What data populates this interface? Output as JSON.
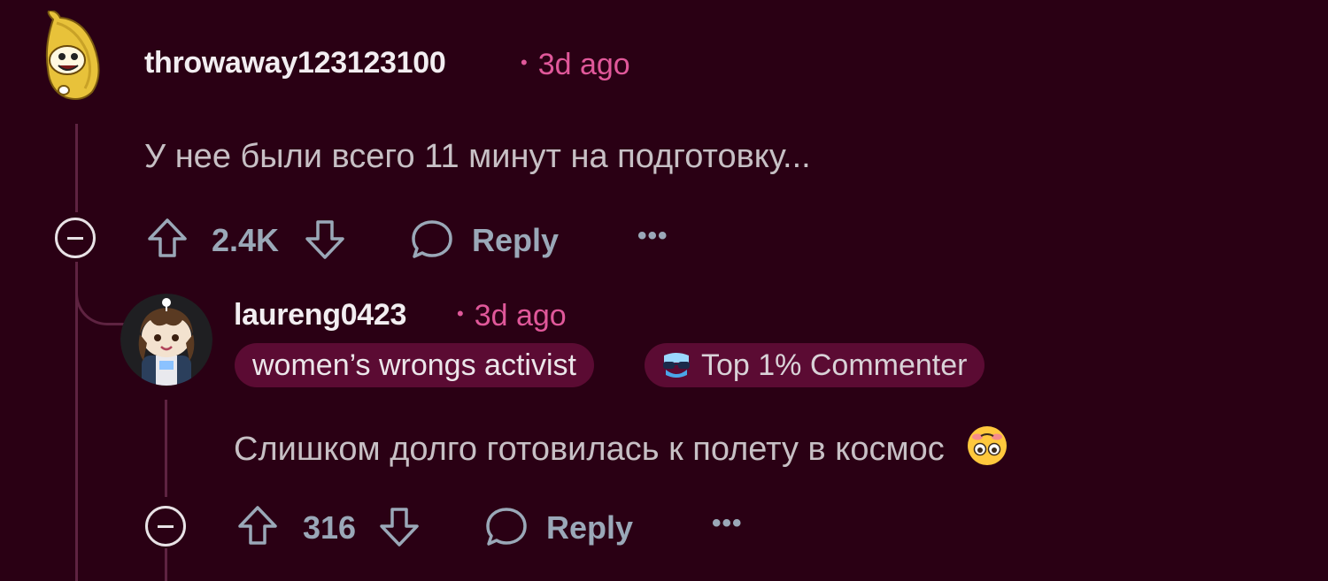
{
  "comments": [
    {
      "username": "throwaway123123100",
      "time": "3d ago",
      "text": "У нее были всего 11 минут на подготовку...",
      "score": "2.4K",
      "reply_label": "Reply",
      "more_label": "•••",
      "avatar_icon": "banana-avatar"
    },
    {
      "username": "laureng0423",
      "time": "3d ago",
      "flair": "women’s wrongs activist",
      "badge_label": "Top 1% Commenter",
      "text": "Слишком долго готовилась к полету в космос",
      "emoji": "flushed-upside-face-emoji",
      "score": "316",
      "reply_label": "Reply",
      "more_label": "•••",
      "avatar_icon": "snoo-avatar"
    }
  ],
  "colors": {
    "background": "#2a0014",
    "timestamp": "#e0589a",
    "flair_bg": "#5b0b33",
    "action_text": "#9aa8b8",
    "thread_line": "#5e2341"
  }
}
